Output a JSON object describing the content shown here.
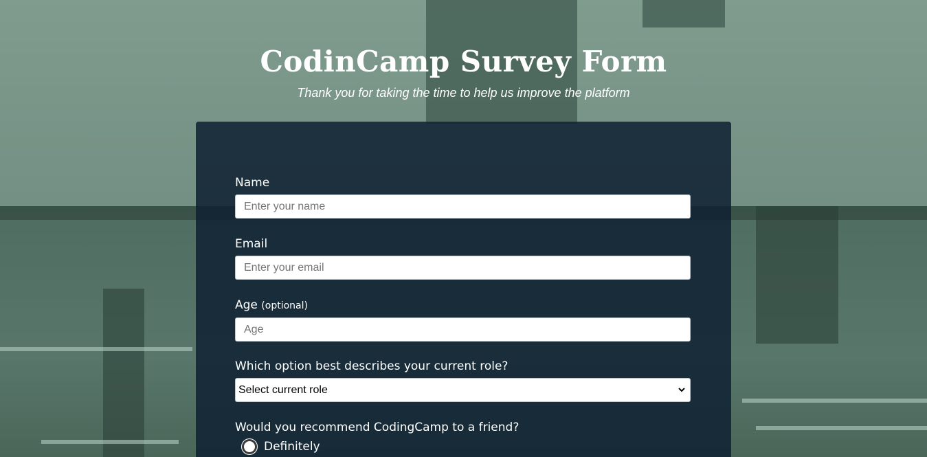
{
  "header": {
    "title": "CodinCamp Survey Form",
    "subtitle": "Thank you for taking the time to help us improve the platform"
  },
  "form": {
    "name": {
      "label": "Name",
      "placeholder": "Enter your name"
    },
    "email": {
      "label": "Email",
      "placeholder": "Enter your email"
    },
    "age": {
      "label": "Age",
      "optional_note": "(optional)",
      "placeholder": "Age"
    },
    "role": {
      "label": "Which option best describes your current role?",
      "selected": "Select current role"
    },
    "recommend": {
      "label": "Would you recommend CodingCamp to a friend?",
      "options": [
        "Definitely"
      ]
    }
  },
  "colors": {
    "card_background": "#0f2132",
    "background_tint": "#5d7a6d",
    "text": "#ffffff"
  }
}
